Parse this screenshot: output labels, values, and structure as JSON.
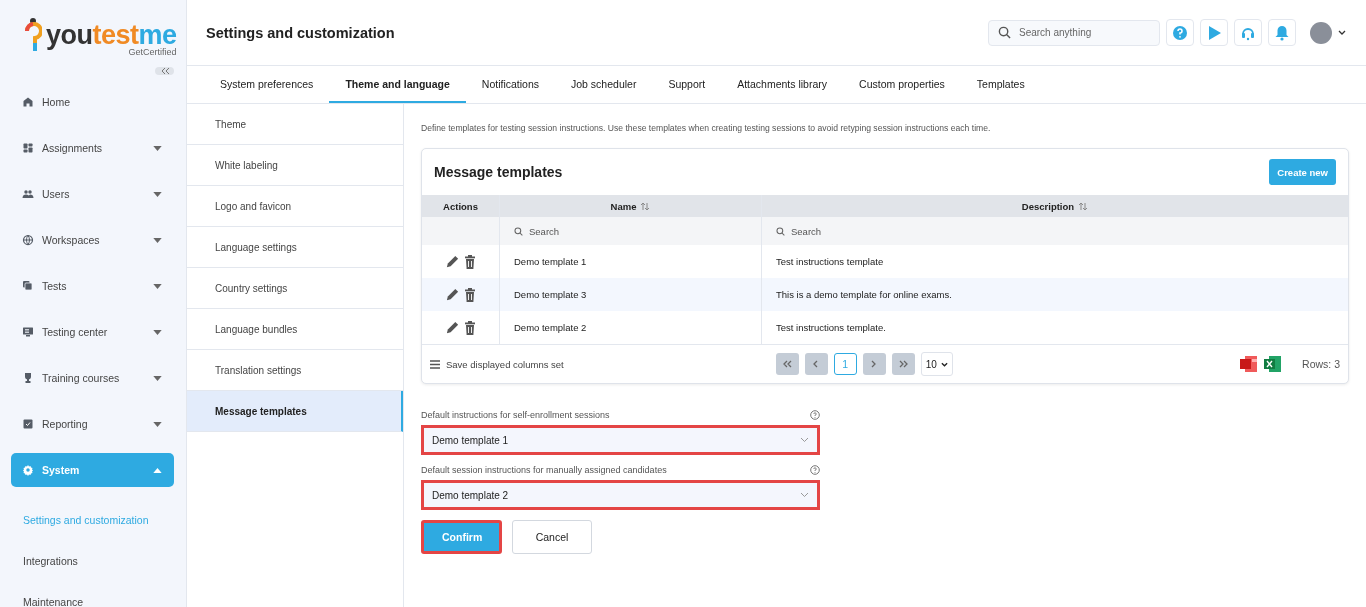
{
  "logo": {
    "parts": [
      "you",
      "test",
      "me"
    ],
    "tagline": "GetCertified"
  },
  "sidebar": {
    "items": [
      {
        "label": "Home",
        "expandable": false,
        "selected": false
      },
      {
        "label": "Assignments",
        "expandable": true,
        "expanded": false,
        "selected": false
      },
      {
        "label": "Users",
        "expandable": true,
        "expanded": false,
        "selected": false
      },
      {
        "label": "Workspaces",
        "expandable": true,
        "expanded": false,
        "selected": false
      },
      {
        "label": "Tests",
        "expandable": true,
        "expanded": false,
        "selected": false
      },
      {
        "label": "Testing center",
        "expandable": true,
        "expanded": false,
        "selected": false
      },
      {
        "label": "Training courses",
        "expandable": true,
        "expanded": false,
        "selected": false
      },
      {
        "label": "Reporting",
        "expandable": true,
        "expanded": false,
        "selected": false
      },
      {
        "label": "System",
        "expandable": true,
        "expanded": true,
        "selected": true,
        "children": [
          {
            "label": "Settings and customization",
            "selected": true
          },
          {
            "label": "Integrations",
            "selected": false
          },
          {
            "label": "Maintenance",
            "selected": false
          }
        ]
      }
    ]
  },
  "header": {
    "title": "Settings and customization",
    "search": {
      "placeholder": "Search anything"
    }
  },
  "tabs": [
    {
      "label": "System preferences",
      "selected": false
    },
    {
      "label": "Theme and language",
      "selected": true
    },
    {
      "label": "Notifications",
      "selected": false
    },
    {
      "label": "Job scheduler",
      "selected": false
    },
    {
      "label": "Support",
      "selected": false
    },
    {
      "label": "Attachments library",
      "selected": false
    },
    {
      "label": "Custom properties",
      "selected": false
    },
    {
      "label": "Templates",
      "selected": false
    }
  ],
  "submenu": [
    {
      "label": "Theme",
      "selected": false
    },
    {
      "label": "White labeling",
      "selected": false
    },
    {
      "label": "Logo and favicon",
      "selected": false
    },
    {
      "label": "Language settings",
      "selected": false
    },
    {
      "label": "Country settings",
      "selected": false
    },
    {
      "label": "Language bundles",
      "selected": false
    },
    {
      "label": "Translation settings",
      "selected": false
    },
    {
      "label": "Message templates",
      "selected": true
    }
  ],
  "description": "Define templates for testing session instructions. Use these templates when creating testing sessions to avoid retyping session instructions each time.",
  "templates": {
    "title": "Message templates",
    "create_button": "Create new",
    "columns": [
      {
        "label": "Actions",
        "sortable": false
      },
      {
        "label": "Name",
        "sortable": true
      },
      {
        "label": "Description",
        "sortable": true
      }
    ],
    "filters": [
      {
        "placeholder": "Search"
      },
      {
        "placeholder": "Search"
      }
    ],
    "rows": [
      {
        "name": "Demo template 1",
        "description": "Test instructions template"
      },
      {
        "name": "Demo template 3",
        "description": "This is a demo template for online exams."
      },
      {
        "name": "Demo template 2",
        "description": "Test instructions template."
      }
    ],
    "save_columns": "Save displayed columns set",
    "current_page": "1",
    "page_size": "10",
    "rows_count": "Rows: 3"
  },
  "form": {
    "fields": [
      {
        "label": "Default instructions for self-enrollment sessions",
        "value": "Demo template 1",
        "highlighted": true
      },
      {
        "label": "Default session instructions for manually assigned candidates",
        "value": "Demo template 2",
        "highlighted": true
      }
    ],
    "buttons": [
      {
        "label": "Confirm",
        "kind": "primary",
        "highlighted": true
      },
      {
        "label": "Cancel",
        "kind": "secondary",
        "highlighted": false
      }
    ]
  }
}
